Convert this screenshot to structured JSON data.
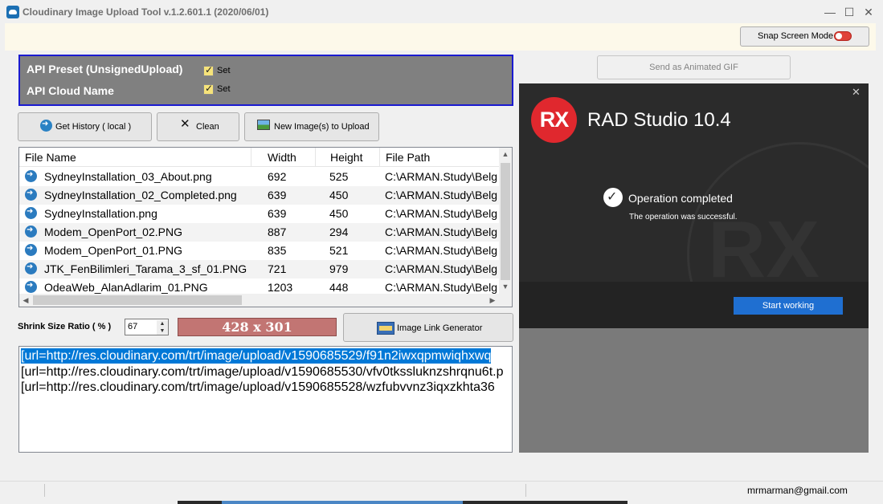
{
  "window": {
    "title": "Cloudinary Image Upload Tool v.1.2.601.1  (2020/06/01)",
    "controls": {
      "minimize": "—",
      "maximize": "☐",
      "close": "✕"
    }
  },
  "toolbar": {
    "snap_label": "Snap Screen Mode",
    "snap_on": false
  },
  "api": {
    "preset_label": "API Preset (UnsignedUpload)",
    "preset_set": "Set",
    "cloud_label": "API Cloud Name",
    "cloud_set": "Set"
  },
  "buttons": {
    "history": "Get History ( local )",
    "clean": "Clean",
    "new_images": "New Image(s) to Upload",
    "send_gif": "Send as Animated GIF",
    "link_gen": "Image Link Generator"
  },
  "table": {
    "columns": [
      "File Name",
      "Width",
      "Height",
      "File Path"
    ],
    "rows": [
      [
        "SydneyInstallation_03_About.png",
        "692",
        "525",
        "C:\\ARMAN.Study\\Belg"
      ],
      [
        "SydneyInstallation_02_Completed.png",
        "639",
        "450",
        "C:\\ARMAN.Study\\Belg"
      ],
      [
        "SydneyInstallation.png",
        "639",
        "450",
        "C:\\ARMAN.Study\\Belg"
      ],
      [
        "Modem_OpenPort_02.PNG",
        "887",
        "294",
        "C:\\ARMAN.Study\\Belg"
      ],
      [
        "Modem_OpenPort_01.PNG",
        "835",
        "521",
        "C:\\ARMAN.Study\\Belg"
      ],
      [
        "JTK_FenBilimleri_Tarama_3_sf_01.PNG",
        "721",
        "979",
        "C:\\ARMAN.Study\\Belg"
      ],
      [
        "OdeaWeb_AlanAdlarim_01.PNG",
        "1203",
        "448",
        "C:\\ARMAN.Study\\Belg"
      ]
    ]
  },
  "shrink": {
    "label": "Shrink Size Ratio ( % )",
    "value": "67",
    "result": "428 x 301"
  },
  "output_lines": [
    "[url=http://res.cloudinary.com/trt/image/upload/v1590685529/f91n2iwxqpmwiqhxwq",
    "[url=http://res.cloudinary.com/trt/image/upload/v1590685530/vfv0tkssluknzshrqnu6t.p",
    "[url=http://res.cloudinary.com/trt/image/upload/v1590685528/wzfubvvnz3iqxzkhta36"
  ],
  "rad_dialog": {
    "logo": "RX",
    "title": "RAD Studio  10.4",
    "watermark": "RX",
    "op_title": "Operation completed",
    "op_sub": "The operation was successful.",
    "start": "Start working",
    "close": "✕"
  },
  "status": {
    "email": "mrmarman@gmail.com"
  },
  "colors": {
    "accent": "#1f6fd1",
    "rx_red": "#e0282e",
    "size_box": "#c27573",
    "selection": "#0078d7"
  }
}
